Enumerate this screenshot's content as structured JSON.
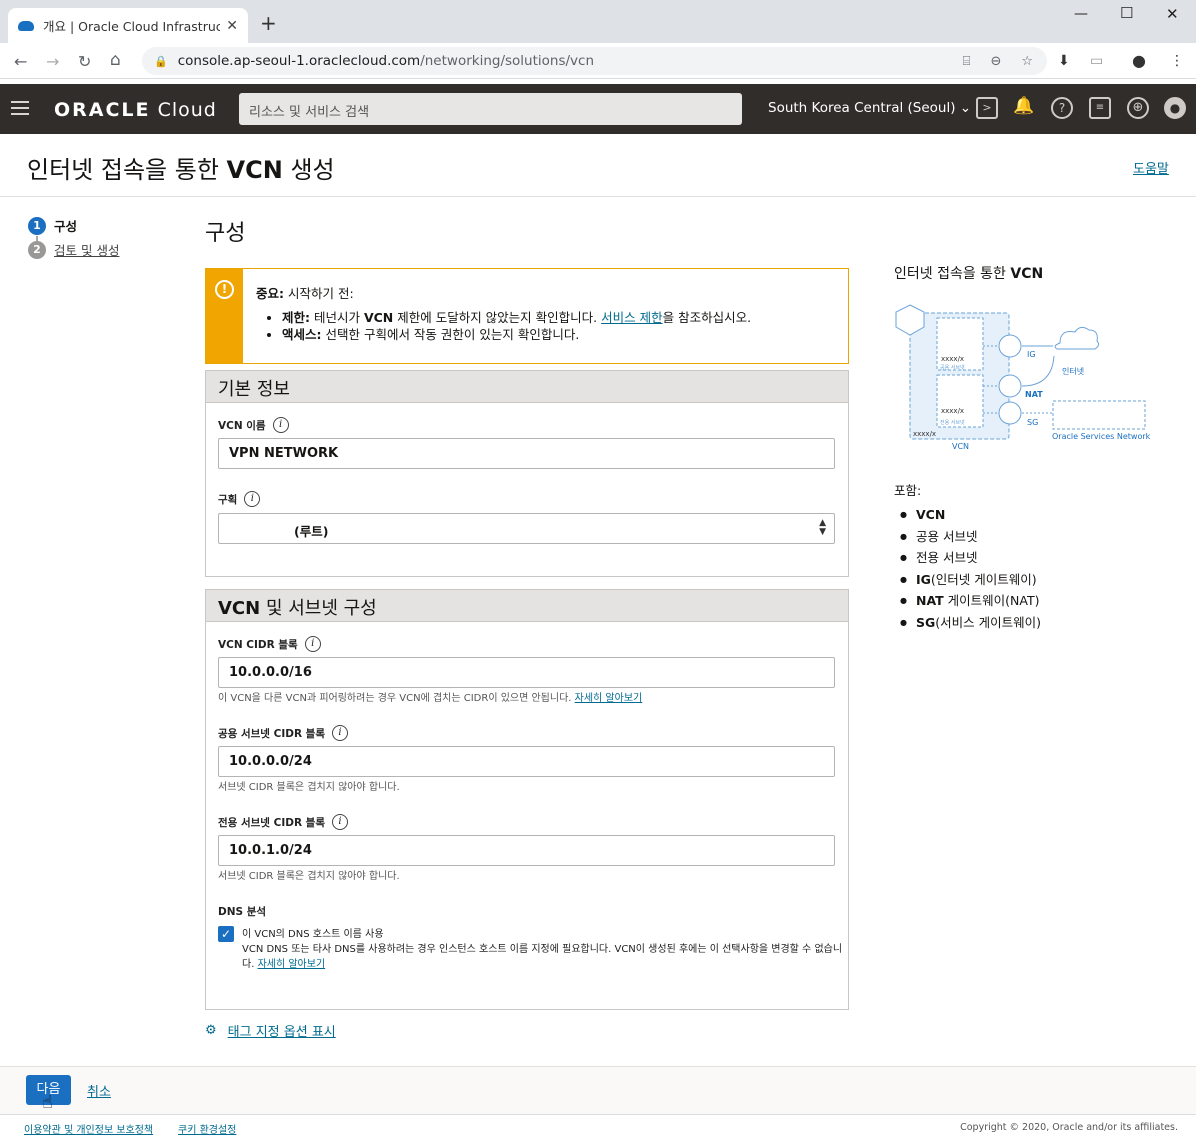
{
  "browser": {
    "tab_title": "개요 | Oracle Cloud Infrastructur",
    "url_domain": "console.ap-seoul-1.oraclecloud.com",
    "url_path": "/networking/solutions/vcn"
  },
  "header": {
    "logo_strong": "ORACLE",
    "logo_light": "Cloud",
    "search_placeholder": "리소스 및 서비스 검색",
    "region": "South Korea Central (Seoul)"
  },
  "page": {
    "title_pre": "인터넷 접속을 통한 ",
    "title_bold": "VCN",
    "title_post": " 생성",
    "help": "도움말"
  },
  "steps": [
    {
      "num": "1",
      "label": "구성"
    },
    {
      "num": "2",
      "label": "검토 및 생성"
    }
  ],
  "section_title": "구성",
  "warning": {
    "lead_bold": "중요:",
    "lead_text": " 시작하기 전:",
    "item1_bold": "제한:",
    "item1_a": " 테넌시가 ",
    "item1_vcn": "VCN",
    "item1_b": " 제한에 도달하지 않았는지 확인합니다. ",
    "item1_link": "서비스 제한",
    "item1_c": "을 참조하십시오.",
    "item2_bold": "액세스:",
    "item2_text": " 선택한 구획에서 작동 권한이 있는지 확인합니다."
  },
  "basic": {
    "header": "기본 정보",
    "vcn_name_label": "VCN 이름",
    "vcn_name_value": "VPN NETWORK",
    "compartment_label": "구획",
    "compartment_value": "(루트)"
  },
  "subnet": {
    "header_bold": "VCN",
    "header_rest": " 및 서브넷 구성",
    "vcn_cidr_label": "VCN CIDR 블록",
    "vcn_cidr_value": "10.0.0.0/16",
    "vcn_cidr_hint": "이 VCN을 다른 VCN과 피어링하려는 경우 VCN에 겹치는 CIDR이 있으면 안됩니다. ",
    "learn_more": "자세히 알아보기",
    "pub_label": "공용 서브넷 CIDR 블록",
    "pub_value": "10.0.0.0/24",
    "pub_hint": "서브넷 CIDR 블록은 겹치지 않아야 합니다.",
    "priv_label": "전용 서브넷 CIDR 블록",
    "priv_value": "10.0.1.0/24",
    "priv_hint": "서브넷 CIDR 블록은 겹치지 않아야 합니다.",
    "dns_label": "DNS 분석",
    "dns_check": "이 VCN의 DNS 호스트 이름 사용",
    "dns_desc": "VCN DNS 또는 타사 DNS를 사용하려는 경우 인스턴스 호스트 이름 지정에 필요합니다. VCN이 생성된 후에는 이 선택사항을 변경할 수 없습니다. ",
    "dns_learn": "자세히 알아보기"
  },
  "tag_option": "태그 지정 옵션 표시",
  "side": {
    "title_pre": "인터넷 접속을 통한 ",
    "title_bold": "VCN",
    "diagram": {
      "ig": "IG",
      "nat": "NAT",
      "sg": "SG",
      "internet": "인터넷",
      "vcn": "VCN",
      "osn": "Oracle Services Network",
      "xxx1": "xxxx/x",
      "xxx2": "xxxx/x",
      "xxx3": "xxxx/x",
      "pub_sn": "공용 서브넷",
      "priv_sn": "전용 서브넷"
    },
    "includes_label": "포함:",
    "includes": [
      {
        "b": "VCN",
        "t": ""
      },
      {
        "b": "",
        "t": "공용 서브넷"
      },
      {
        "b": "",
        "t": "전용 서브넷"
      },
      {
        "b": "IG",
        "t": "(인터넷 게이트웨이)"
      },
      {
        "b": "NAT",
        "t": " 게이트웨이(NAT)"
      },
      {
        "b": "SG",
        "t": "(서비스 게이트웨이)"
      }
    ]
  },
  "footer": {
    "next": "다음",
    "cancel": "취소",
    "terms": "이용약관 및 개인정보 보호정책",
    "cookies": "쿠키 환경설정",
    "copyright": "Copyright © 2020, Oracle and/or its affiliates."
  },
  "colors": {
    "accent": "#1a6fc1",
    "header_bg": "#312d2a",
    "warning": "#f0a500",
    "link": "#006b8f"
  }
}
